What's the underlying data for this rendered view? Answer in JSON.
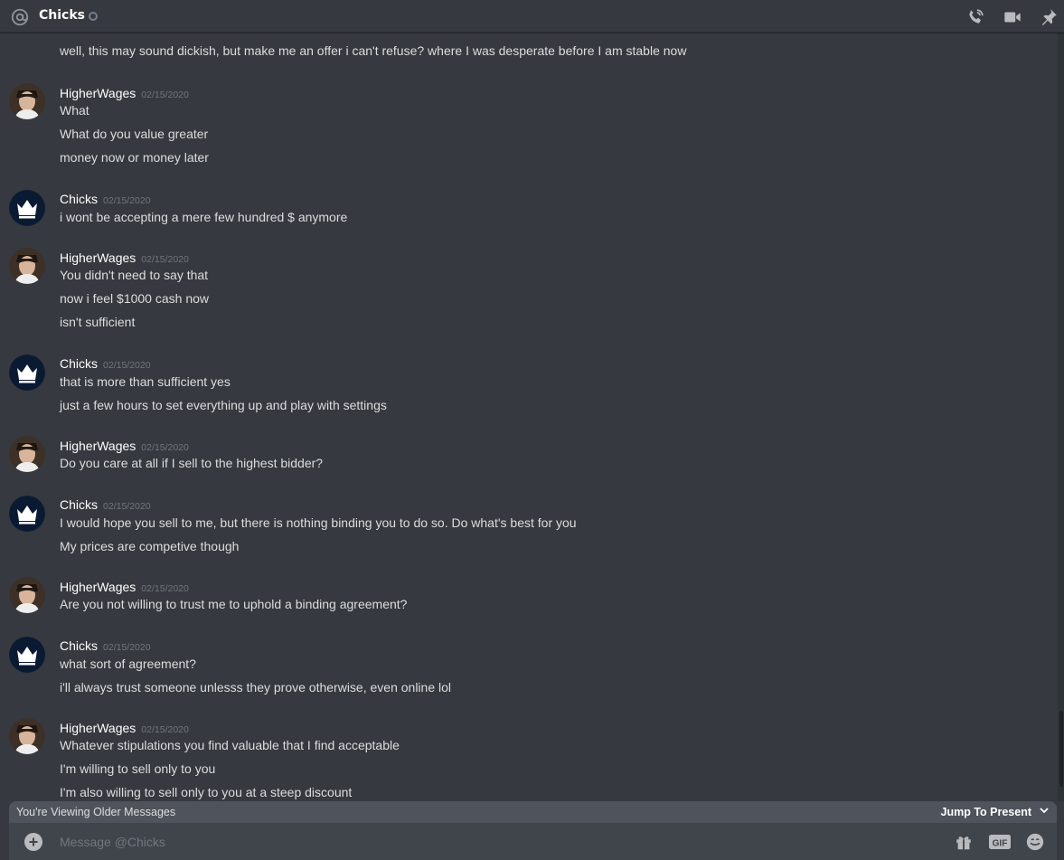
{
  "header": {
    "title": "Chicks",
    "status": "offline",
    "icons": [
      "at-icon",
      "phone-call-icon",
      "video-call-icon",
      "pin-icon"
    ]
  },
  "colors": {
    "background": "#36393f",
    "text": "#dcddde",
    "author": "#ffffff",
    "timestamp": "#72767d",
    "bar": "#4f545c",
    "composer": "#40444b"
  },
  "messages": {
    "partial_top": {
      "author": "Chicks",
      "lines": [
        "well, this may sound dickish, but make me an offer i can't refuse? where I was desperate before I am stable now"
      ]
    },
    "groups": [
      {
        "author": "HigherWages",
        "avatar": "person",
        "timestamp": "02/15/2020",
        "lines": [
          "What",
          "What do you value greater",
          "money now or money later"
        ]
      },
      {
        "author": "Chicks",
        "avatar": "crown",
        "timestamp": "02/15/2020",
        "lines": [
          "i wont be accepting a mere few hundred $ anymore"
        ]
      },
      {
        "author": "HigherWages",
        "avatar": "person",
        "timestamp": "02/15/2020",
        "lines": [
          "You didn't need to say that",
          "now i feel $1000 cash now",
          "isn't sufficient"
        ]
      },
      {
        "author": "Chicks",
        "avatar": "crown",
        "timestamp": "02/15/2020",
        "lines": [
          "that is more than sufficient yes",
          "just a few hours to set everything up and play with settings"
        ]
      },
      {
        "author": "HigherWages",
        "avatar": "person",
        "timestamp": "02/15/2020",
        "lines": [
          "Do you care at all if I sell to the highest bidder?"
        ]
      },
      {
        "author": "Chicks",
        "avatar": "crown",
        "timestamp": "02/15/2020",
        "lines": [
          "I would hope you sell to me, but there is nothing binding you to do so. Do what's best for you",
          "My prices are competive though"
        ]
      },
      {
        "author": "HigherWages",
        "avatar": "person",
        "timestamp": "02/15/2020",
        "lines": [
          "Are you not willing to trust me to uphold a binding agreement?"
        ]
      },
      {
        "author": "Chicks",
        "avatar": "crown",
        "timestamp": "02/15/2020",
        "lines": [
          "what sort of agreement?",
          "i'll always trust someone unlesss they prove otherwise, even online lol"
        ]
      },
      {
        "author": "HigherWages",
        "avatar": "person",
        "timestamp": "02/15/2020",
        "lines": [
          "Whatever stipulations you find valuable that I find acceptable",
          "I'm willing to sell only to you",
          "I'm also willing to sell only to you at a steep discount"
        ]
      }
    ]
  },
  "older_bar": {
    "text": "You're Viewing Older Messages",
    "jump_label": "Jump To Present"
  },
  "composer": {
    "placeholder": "Message @Chicks",
    "icons": [
      "add-attachment-icon",
      "gift-icon",
      "gif-icon",
      "emoji-icon"
    ]
  }
}
